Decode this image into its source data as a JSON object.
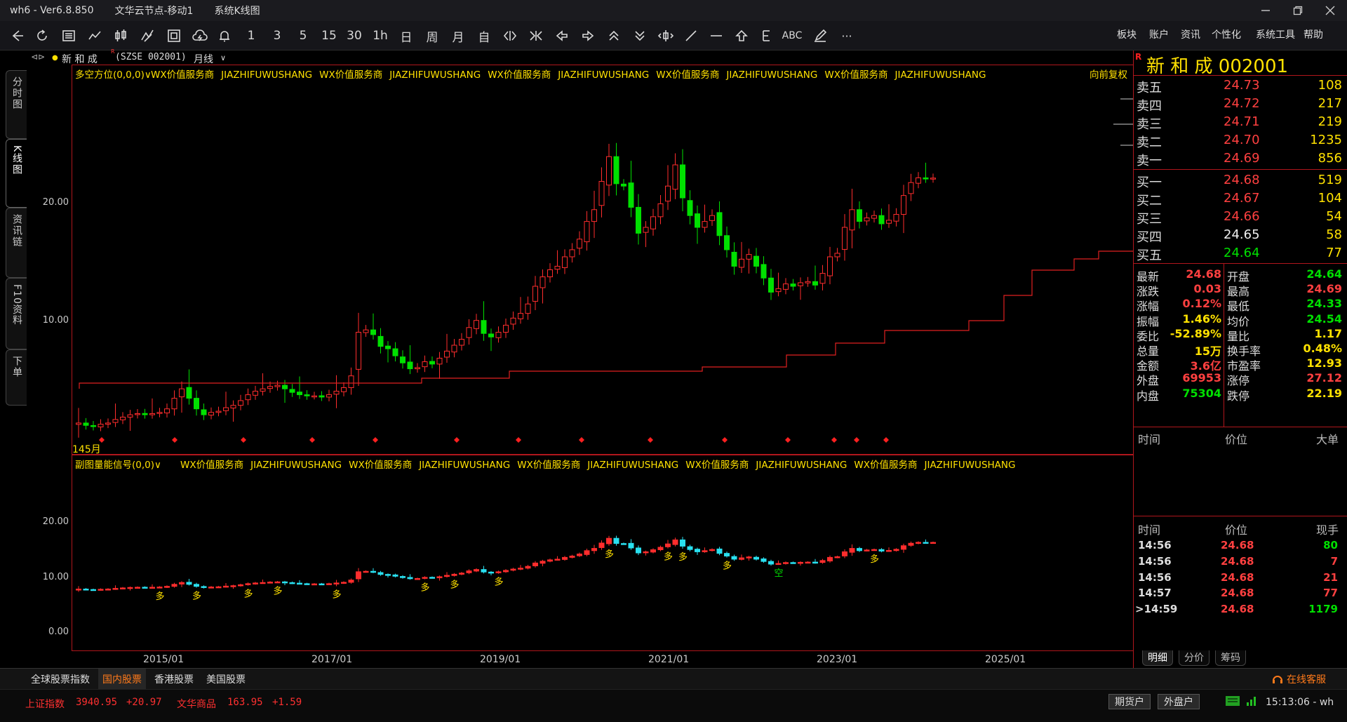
{
  "titlebar": {
    "app": "wh6  -  Ver6.8.850",
    "node": "文华云节点-移动1",
    "view": "系统K线图",
    "min_icon": "minimize-icon",
    "restore_icon": "restore-icon",
    "close_icon": "close-icon"
  },
  "toolbar": {
    "periods": [
      "1",
      "3",
      "5",
      "15",
      "30",
      "1h",
      "日",
      "周",
      "月",
      "自"
    ],
    "abc_label": "ABC",
    "more_label": "···",
    "menu": [
      "板块",
      "账户",
      "资讯",
      "个性化",
      "系统工具",
      "帮助"
    ]
  },
  "left_tabs": [
    "分时图",
    "K线图",
    "资讯链",
    "F10资料",
    "下单"
  ],
  "stock_header": {
    "name": "新 和 成",
    "code": "(SZSE 002001)",
    "period": "月线"
  },
  "main_chart": {
    "indicator": "多空方位(0,0,0)",
    "ads": [
      "WX价值服务商",
      "JIAZHIFUWUSHANG",
      "WX价值服务商",
      "JIAZHIFUWUSHANG",
      "WX价值服务商",
      "JIAZHIFUWUSHANG",
      "WX价值服务商",
      "JIAZHIFUWUSHANG",
      "WX价值服务商",
      "JIAZHIFUWUSHANG"
    ],
    "adjust": "向前复权",
    "bar_count": "145月",
    "y_ticks": [
      "20.00",
      "10.00"
    ]
  },
  "sub_chart": {
    "indicator": "副图量能信号(0,0)",
    "ads": [
      "WX价值服务商",
      "JIAZHIFUWUSHANG",
      "WX价值服务商",
      "JIAZHIFUWUSHANG",
      "WX价值服务商",
      "JIAZHIFUWUSHANG",
      "WX价值服务商",
      "JIAZHIFUWUSHANG",
      "WX价值服务商",
      "JIAZHIFUWUSHANG"
    ],
    "y_ticks": [
      "20.00",
      "10.00",
      "0.00"
    ],
    "signals_duo": "多",
    "signals_kong": "空"
  },
  "x_dates": [
    "2015/01",
    "2017/01",
    "2019/01",
    "2021/01",
    "2023/01",
    "2025/01"
  ],
  "quote": {
    "r_mark": "R",
    "title": "新 和 成  002001",
    "asks": [
      {
        "label": "卖五",
        "price": "24.73",
        "vol": "108"
      },
      {
        "label": "卖四",
        "price": "24.72",
        "vol": "217"
      },
      {
        "label": "卖三",
        "price": "24.71",
        "vol": "219"
      },
      {
        "label": "卖二",
        "price": "24.70",
        "vol": "1235"
      },
      {
        "label": "卖一",
        "price": "24.69",
        "vol": "856"
      }
    ],
    "bids": [
      {
        "label": "买一",
        "price": "24.68",
        "vol": "519"
      },
      {
        "label": "买二",
        "price": "24.67",
        "vol": "104"
      },
      {
        "label": "买三",
        "price": "24.66",
        "vol": "54"
      },
      {
        "label": "买四",
        "price": "24.65",
        "vol": "58"
      },
      {
        "label": "买五",
        "price": "24.64",
        "vol": "77"
      }
    ],
    "stats": [
      {
        "l1": "最新",
        "v1": "24.68",
        "l2": "开盘",
        "v2": "24.64"
      },
      {
        "l1": "涨跌",
        "v1": "0.03",
        "l2": "最高",
        "v2": "24.69"
      },
      {
        "l1": "涨幅",
        "v1": "0.12%",
        "l2": "最低",
        "v2": "24.33"
      },
      {
        "l1": "振幅",
        "v1": "1.46%",
        "l2": "均价",
        "v2": "24.54"
      },
      {
        "l1": "委比",
        "v1": "-52.89%",
        "l2": "量比",
        "v2": "1.17"
      },
      {
        "l1": "总量",
        "v1": "15万",
        "l2": "换手率",
        "v2": "0.48%"
      },
      {
        "l1": "金额",
        "v1": "3.6亿",
        "l2": "市盈率",
        "v2": "12.93"
      },
      {
        "l1": "外盘",
        "v1": "69953",
        "l2": "涨停",
        "v2": "27.12"
      },
      {
        "l1": "内盘",
        "v1": "75304",
        "l2": "跌停",
        "v2": "22.19"
      }
    ],
    "big_hdr": [
      "时间",
      "价位",
      "大单"
    ],
    "tick_hdr": [
      "时间",
      "价位",
      "现手"
    ],
    "ticks": [
      {
        "time": "14:56",
        "price": "24.68",
        "vol": "80"
      },
      {
        "time": "14:56",
        "price": "24.68",
        "vol": "7"
      },
      {
        "time": "14:56",
        "price": "24.68",
        "vol": "21"
      },
      {
        "time": "14:57",
        "price": "24.68",
        "vol": "77"
      },
      {
        "time": ">14:59",
        "price": "24.68",
        "vol": "1179"
      }
    ],
    "tabs": [
      "明细",
      "分价",
      "筹码"
    ]
  },
  "market_tabs": [
    "全球股票指数",
    "国内股票",
    "香港股票",
    "美国股票"
  ],
  "service": "在线客服",
  "status": {
    "idx1_name": "上证指数",
    "idx1_val": "3940.95",
    "idx1_chg": "+20.97",
    "idx2_name": "文华商品",
    "idx2_val": "163.95",
    "idx2_chg": "+1.59",
    "btn_futures": "期货户",
    "btn_foreign": "外盘户",
    "clock": "15:13:06 - wh"
  },
  "colors": {
    "up": "#ff2d2d",
    "down": "#00e000",
    "sub_down": "#29e0f0",
    "yellow": "#ffe100",
    "border": "#b0161c"
  },
  "chart_data": {
    "type": "candlestick",
    "title": "",
    "xlabel": "",
    "ylabel": "",
    "ylim": [
      1,
      28
    ],
    "x_tick_labels": [
      "2015/01",
      "2017/01",
      "2019/01",
      "2021/01",
      "2023/01",
      "2025/01"
    ],
    "series": [
      {
        "values": [
          3.9,
          3.7,
          3.6,
          3.8,
          3.9,
          4.2,
          4.4,
          4.6,
          4.7,
          4.6,
          4.7,
          4.8,
          5.1,
          6.0,
          6.8,
          6.0,
          5.1,
          4.6,
          4.8,
          4.9,
          5.2,
          5.4,
          5.8,
          6.3,
          6.6,
          6.8,
          7.0,
          7.1,
          6.8,
          6.5,
          6.3,
          6.2,
          6.2,
          6.1,
          6.3,
          6.6,
          6.9,
          7.9,
          11.6,
          11.8,
          11.4,
          10.4,
          10.2,
          9.6,
          9.0,
          8.5,
          8.6,
          9.1,
          8.9,
          9.4,
          10.0,
          10.5,
          11.0,
          12.0,
          12.6,
          11.5,
          11.2,
          11.6,
          12.2,
          12.8,
          13.2,
          14.0,
          15.5,
          16.3,
          16.9,
          17.2,
          18.0,
          18.6,
          19.5,
          21.0,
          22.0,
          24.4,
          26.5,
          24.2,
          24.0,
          22.2,
          20.0,
          20.5,
          21.4,
          22.5,
          24.0,
          25.8,
          23.0,
          21.5,
          20.5,
          21.0,
          21.5,
          19.8,
          18.6,
          17.2,
          17.8,
          18.2,
          17.2,
          16.2,
          15.0,
          15.3,
          15.7,
          15.5,
          15.8,
          15.9,
          15.6,
          16.6,
          18.0,
          18.3,
          20.5,
          22.0,
          21.0,
          21.3,
          21.5,
          20.8,
          21.1,
          21.6,
          23.2,
          24.3,
          24.7,
          24.6,
          24.68
        ]
      }
    ],
    "threshold_line_note": "step line (red)",
    "signals": {
      "duo_indices": [
        11,
        16,
        23,
        27,
        35,
        47,
        51,
        57,
        72,
        80,
        82,
        88,
        108
      ],
      "kong_indices": [
        95
      ]
    }
  }
}
